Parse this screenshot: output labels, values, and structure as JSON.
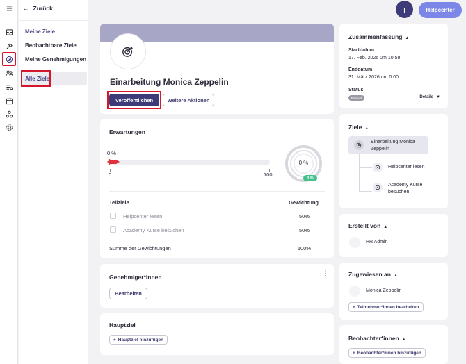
{
  "nav": {
    "back_label": "Zurück",
    "items": [
      {
        "label": "Meine Ziele"
      },
      {
        "label": "Beobachtbare Ziele"
      },
      {
        "label": "Meine Genehmigungen"
      },
      {
        "label": "Alle Ziele"
      }
    ]
  },
  "topbar": {
    "add_label": "+",
    "help_label": "Helpcenter"
  },
  "goal": {
    "title": "Einarbeitung Monica Zeppelin",
    "publish_label": "Veröffentlichen",
    "more_actions_label": "Weitere Aktionen"
  },
  "expectations": {
    "title": "Erwartungen",
    "progress_label": "0 %",
    "progress_fraction": 0,
    "min_label": "0",
    "max_label": "100",
    "gauge_label": "0 %",
    "gauge_badge": "0 %"
  },
  "subgoals": {
    "col_name": "Teilziele",
    "col_weight": "Gewichtung",
    "rows": [
      {
        "name": "Helpcenter lesen",
        "weight": "50%"
      },
      {
        "name": "Academy Kurse besuchen",
        "weight": "50%"
      }
    ],
    "sum_label": "Summe der Gewichtungen",
    "sum_value": "100%"
  },
  "approvers": {
    "title": "Genehmiger*innen",
    "edit_label": "Bearbeiten"
  },
  "main_goal": {
    "title": "Hauptziel",
    "add_label": "Hauptziel hinzufügen"
  },
  "summary": {
    "title": "Zusammenfassung",
    "start_label": "Startdatum",
    "start_value": "17. Feb. 2026 um 10:58",
    "end_label": "Enddatum",
    "end_value": "31. März 2026 um 0:00",
    "status_label": "Status",
    "status_value": "Entwurf",
    "details_label": "Details"
  },
  "goals_tree": {
    "title": "Ziele",
    "root": "Einarbeitung Monica Zeppelin",
    "children": [
      "Helpcenter lesen",
      "Academy Kurse besuchen"
    ]
  },
  "created_by": {
    "title": "Erstellt von",
    "name": "HR Admin"
  },
  "assigned": {
    "title": "Zugewiesen an",
    "name": "Monica Zeppelin",
    "edit_label": "Teilnehmer*innen bearbeiten"
  },
  "observers": {
    "title": "Beobachter*innen",
    "add_label": "Beobachter*innen hinzufügen"
  },
  "colors": {
    "accent": "#3d3b78",
    "highlight": "#d4172c",
    "header_band": "#a7a6c6",
    "progress_red": "#e0303e",
    "badge_green": "#45c08a"
  }
}
